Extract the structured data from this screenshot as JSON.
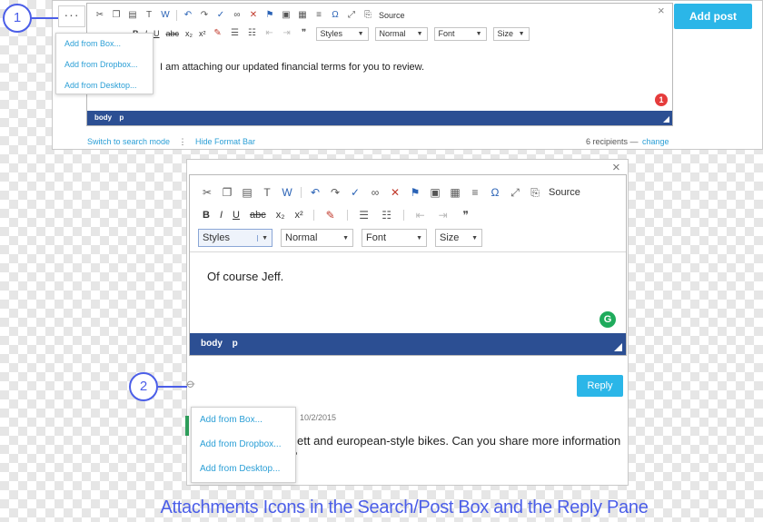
{
  "top": {
    "more_label": "···",
    "attach_menu": [
      "Add from Box...",
      "Add from Dropbox...",
      "Add from Desktop..."
    ],
    "toolbar": {
      "source_label": "Source",
      "styles": "Styles",
      "format": "Normal",
      "font": "Font",
      "size": "Size",
      "format_buttons": [
        "B",
        "I",
        "U",
        "abc",
        "x₂",
        "x²"
      ]
    },
    "message": "I am attaching our updated financial terms for you to review.",
    "badge": "1",
    "statusbar": [
      "body",
      "p"
    ],
    "add_post": "Add post",
    "close": "×",
    "footer": {
      "search_mode": "Switch to search mode",
      "divider": "⋮",
      "hide_format": "Hide Format Bar",
      "recipients": "6 recipients —",
      "change": "change"
    }
  },
  "reply": {
    "toolbar": {
      "source_label": "Source",
      "styles": "Styles",
      "format": "Normal",
      "font": "Font",
      "size": "Size",
      "format_buttons": [
        "B",
        "I",
        "U",
        "abc",
        "x₂",
        "x²"
      ]
    },
    "message": "Of course Jeff.",
    "grammarly": "G",
    "statusbar": [
      "body",
      "p"
    ],
    "reply_label": "Reply",
    "close": "×",
    "attach_menu": [
      "Add from Box...",
      "Add from Dropbox...",
      "Add from Desktop..."
    ],
    "timestamp": "10/2/2015",
    "preview_line1": "ett and european-style bikes. Can you share more information",
    "preview_line2": "?"
  },
  "callouts": [
    "1",
    "2"
  ],
  "caption": "Attachments Icons in the Search/Post Box and the Reply Pane",
  "colors": {
    "accent": "#2bb6e8",
    "statusbar": "#2c4f93",
    "callout": "#4b5ee8",
    "link": "#2b9fd6",
    "badge": "#e53c3c",
    "grammarly": "#1fab5c"
  }
}
